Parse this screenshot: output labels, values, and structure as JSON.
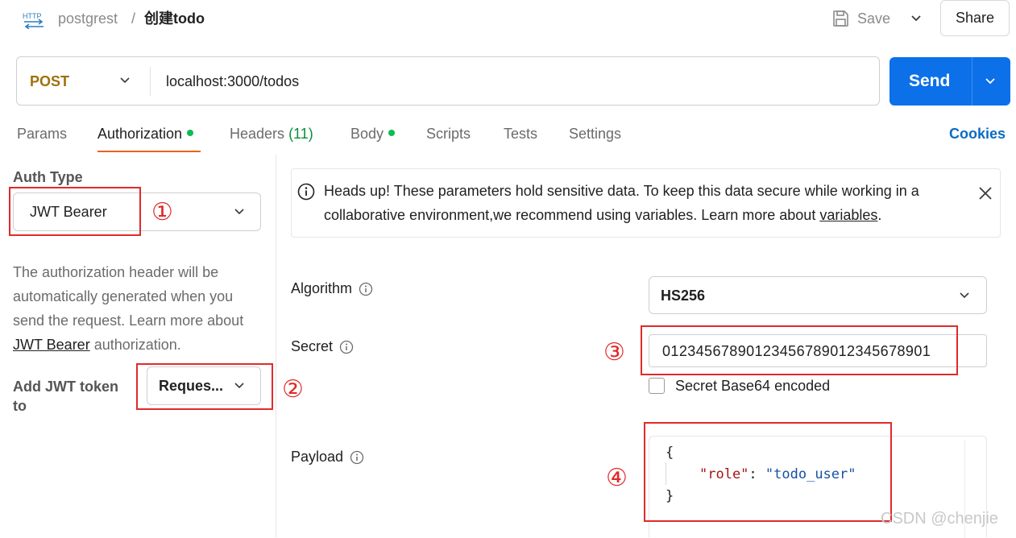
{
  "header": {
    "http_icon_label": "HTTP",
    "collection": "postgrest",
    "separator": "/",
    "request_name": "创建todo",
    "save_label": "Save",
    "share_label": "Share"
  },
  "request": {
    "method": "POST",
    "url": "localhost:3000/todos",
    "send_label": "Send",
    "method_color": "#a0700a",
    "send_color": "#0c70e8"
  },
  "tabs": [
    {
      "label": "Params"
    },
    {
      "label": "Authorization",
      "active": true,
      "dot": true
    },
    {
      "label": "Headers",
      "count": "(11)"
    },
    {
      "label": "Body",
      "dot": true
    },
    {
      "label": "Scripts"
    },
    {
      "label": "Tests"
    },
    {
      "label": "Settings"
    }
  ],
  "cookies_label": "Cookies",
  "left_panel": {
    "auth_type_label": "Auth Type",
    "auth_type_value": "JWT Bearer",
    "description_prefix": "The authorization header will be automatically generated when you send the request. Learn more about ",
    "description_link": "JWT Bearer",
    "description_suffix": " authorization.",
    "add_token_label": "Add JWT token to",
    "add_token_value": "Reques..."
  },
  "banner": {
    "text": "Heads up! These parameters hold sensitive data. To keep this data secure while working in a collaborative environment,we recommend using variables. Learn more about ",
    "link": "variables",
    "suffix": "."
  },
  "fields": {
    "algorithm_label": "Algorithm",
    "algorithm_value": "HS256",
    "secret_label": "Secret",
    "secret_value": "01234567890123456789012345678901",
    "base64_label": "Secret Base64 encoded",
    "base64_checked": false,
    "payload_label": "Payload",
    "payload_open": "{",
    "payload_key": "\"role\"",
    "payload_colon": ": ",
    "payload_value": "\"todo_user\"",
    "payload_close": "}"
  },
  "annotations": [
    "①",
    "②",
    "③",
    "④"
  ],
  "annotation_color": "#e02a2a",
  "watermark": "CSDN @chenjie"
}
